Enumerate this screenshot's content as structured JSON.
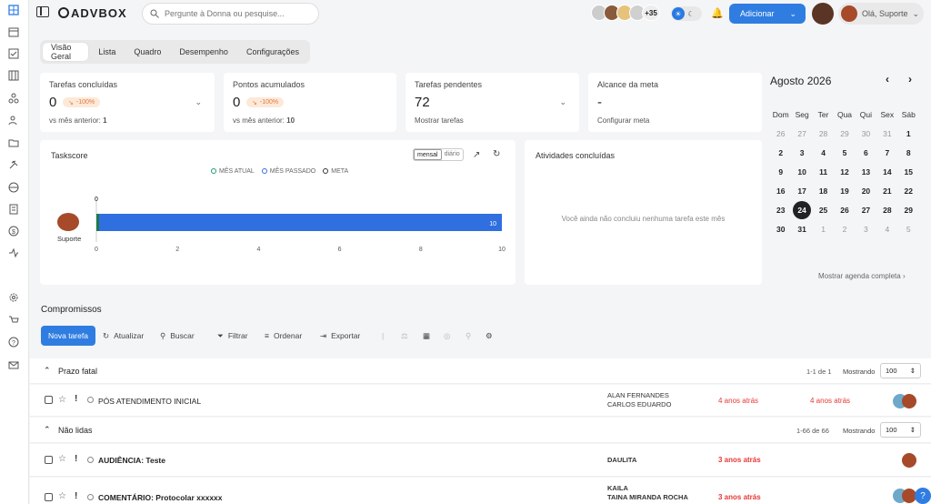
{
  "brand": {
    "logo": "ADVBOX"
  },
  "search": {
    "placeholder": "Pergunte à Donna ou pesquise..."
  },
  "header": {
    "avatar_count": "+35",
    "add_label": "Adicionar",
    "user_greeting": "Olá, Suporte"
  },
  "tabs": [
    "Visão Geral",
    "Lista",
    "Quadro",
    "Desempenho",
    "Configurações"
  ],
  "kpis": [
    {
      "title": "Tarefas concluídas",
      "value": "0",
      "badge": "-100%",
      "sub_prefix": "vs mês anterior: ",
      "sub_value": "1"
    },
    {
      "title": "Pontos acumulados",
      "value": "0",
      "badge": "-100%",
      "sub_prefix": "vs mês anterior: ",
      "sub_value": "10"
    },
    {
      "title": "Tarefas pendentes",
      "value": "72",
      "sub": "Mostrar tarefas"
    },
    {
      "title": "Alcance da meta",
      "value": "-",
      "sub": "Configurar meta"
    }
  ],
  "taskscore": {
    "title": "Taskscore",
    "toggle": [
      "mensal",
      "diário"
    ],
    "legend": [
      "MÊS ATUAL",
      "MÊS PASSADO",
      "META"
    ],
    "user": "Suporte"
  },
  "chart_data": {
    "type": "bar",
    "orientation": "horizontal",
    "title": "Taskscore",
    "categories": [
      "Suporte"
    ],
    "series": [
      {
        "name": "MÊS ATUAL",
        "values": [
          0
        ],
        "color": "#1f7a4d"
      },
      {
        "name": "MÊS PASSADO",
        "values": [
          10
        ],
        "color": "#2f6fe0"
      }
    ],
    "data_labels": [
      "0",
      "10"
    ],
    "xlim": [
      0,
      10
    ],
    "xticks": [
      "0",
      "2",
      "4",
      "6",
      "8",
      "10"
    ]
  },
  "activities": {
    "title": "Atividades concluídas",
    "empty": "Você ainda não concluiu nenhuma tarefa este mês"
  },
  "calendar": {
    "title": "Agosto 2026",
    "weekdays": [
      "Dom",
      "Seg",
      "Ter",
      "Qua",
      "Qui",
      "Sex",
      "Sáb"
    ],
    "weeks": [
      [
        "26",
        "27",
        "28",
        "29",
        "30",
        "31",
        "1"
      ],
      [
        "2",
        "3",
        "4",
        "5",
        "6",
        "7",
        "8"
      ],
      [
        "9",
        "10",
        "11",
        "12",
        "13",
        "14",
        "15"
      ],
      [
        "16",
        "17",
        "18",
        "19",
        "20",
        "21",
        "22"
      ],
      [
        "23",
        "24",
        "25",
        "26",
        "27",
        "28",
        "29"
      ],
      [
        "30",
        "31",
        "1",
        "2",
        "3",
        "4",
        "5"
      ]
    ],
    "today": "24",
    "link": "Mostrar agenda completa"
  },
  "compromissos": {
    "title": "Compromissos",
    "toolbar": {
      "new": "Nova tarefa",
      "refresh": "Atualizar",
      "search": "Buscar",
      "filter": "Filtrar",
      "sort": "Ordenar",
      "export": "Exportar"
    },
    "groups": [
      {
        "name": "Prazo fatal",
        "count": "1-1 de 1",
        "show_label": "Mostrando",
        "page_size": "100"
      },
      {
        "name": "Não lidas",
        "count": "1-66 de 66",
        "show_label": "Mostrando",
        "page_size": "100"
      }
    ],
    "tasks": [
      {
        "name": "PÓS ATENDIMENTO INICIAL",
        "resp1": "ALAN FERNANDES",
        "resp2": "CARLOS EDUARDO",
        "t1": "4 anos atrás",
        "t2": "4 anos atrás"
      },
      {
        "name": "AUDIÊNCIA: Teste",
        "resp1": "DAULITA",
        "resp2": "",
        "t1": "3 anos atrás",
        "t2": ""
      },
      {
        "name": "COMENTÁRIO: Protocolar xxxxxx",
        "resp1": "KAILA",
        "resp2": "TAINA MIRANDA ROCHA",
        "t1": "3 anos atrás",
        "t2": ""
      }
    ]
  }
}
